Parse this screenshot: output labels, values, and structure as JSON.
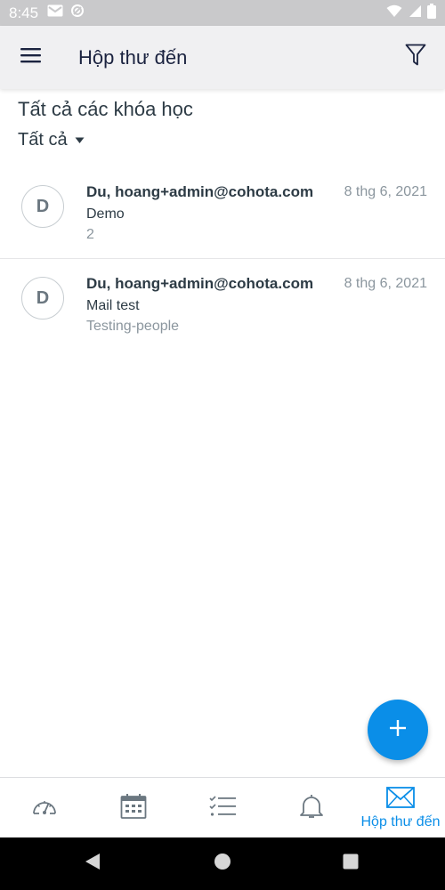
{
  "status_bar": {
    "time": "8:45"
  },
  "app_bar": {
    "title": "Hộp thư đến"
  },
  "course_filter": {
    "heading": "Tất cả các khóa học",
    "selected": "Tất cả"
  },
  "messages": [
    {
      "avatar_initial": "D",
      "sender": "Du, hoang+admin@cohota.com",
      "date": "8 thg 6, 2021",
      "subject": "Demo",
      "preview": "2"
    },
    {
      "avatar_initial": "D",
      "sender": "Du, hoang+admin@cohota.com",
      "date": "8 thg 6, 2021",
      "subject": "Mail test",
      "preview": "Testing-people"
    }
  ],
  "bottom_nav": {
    "items": [
      {
        "icon": "dashboard-icon",
        "label": ""
      },
      {
        "icon": "calendar-icon",
        "label": ""
      },
      {
        "icon": "todo-list-icon",
        "label": ""
      },
      {
        "icon": "bell-icon",
        "label": ""
      },
      {
        "icon": "mail-icon",
        "label": "Hộp thư đến",
        "active": true
      }
    ]
  },
  "colors": {
    "accent": "#0a8ee8",
    "primary_text": "#2d3b45",
    "secondary_text": "#8b969e",
    "app_bar_bg": "#f0f0f2",
    "status_bar_bg": "#c9c9cb",
    "icon_gray": "#6b7780"
  }
}
